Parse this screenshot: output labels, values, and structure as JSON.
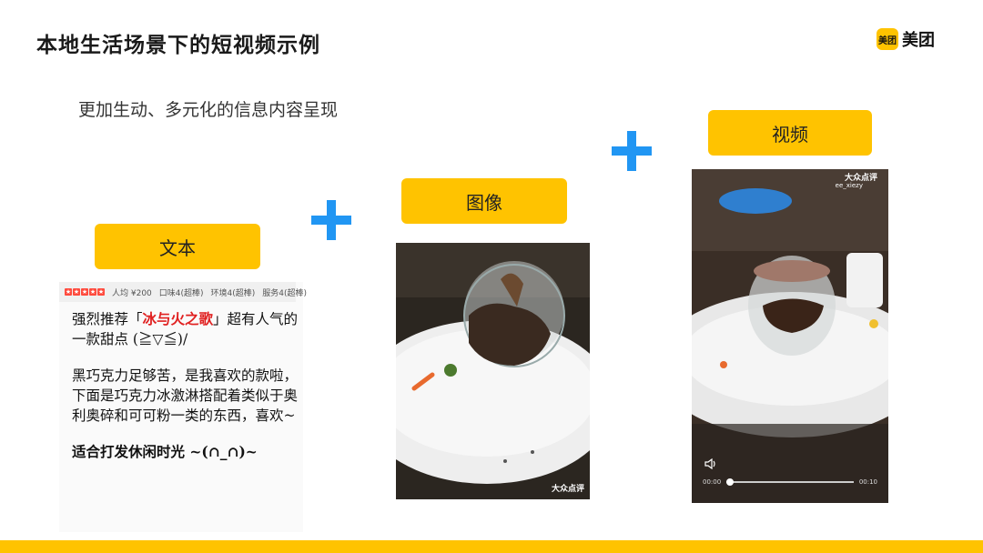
{
  "header": {
    "title": "本地生活场景下的短视频示例",
    "logo_badge": "美团",
    "logo_text": "美团"
  },
  "subtitle": "更加生动、多元化的信息内容呈现",
  "tags": {
    "text": "文本",
    "image": "图像",
    "video": "视频"
  },
  "review": {
    "rating_stars": 5,
    "meta": {
      "avg_price": "人均 ¥200",
      "taste": "口味4(超棒)",
      "env": "环境4(超棒)",
      "service": "服务4(超棒)"
    },
    "p1_before": "强烈推荐「",
    "p1_highlight": "冰与火之歌",
    "p1_after": "」超有人气的一款甜点 (≧▽≦)/",
    "p2": "黑巧克力足够苦，是我喜欢的款啦，下面是巧克力冰激淋搭配着类似于奥利奥碎和可可粉一类的东西，喜欢~",
    "p3": "适合打发休闲时光 ~(∩_∩)~"
  },
  "photo": {
    "watermark": "大众点评"
  },
  "video": {
    "watermark": "大众点评",
    "user": "ee_xiezy",
    "time_current": "00:00",
    "time_total": "00:10",
    "progress": 0
  },
  "colors": {
    "accent_yellow": "#FFC300",
    "plus_blue": "#2196F3",
    "highlight_red": "#e02020"
  }
}
